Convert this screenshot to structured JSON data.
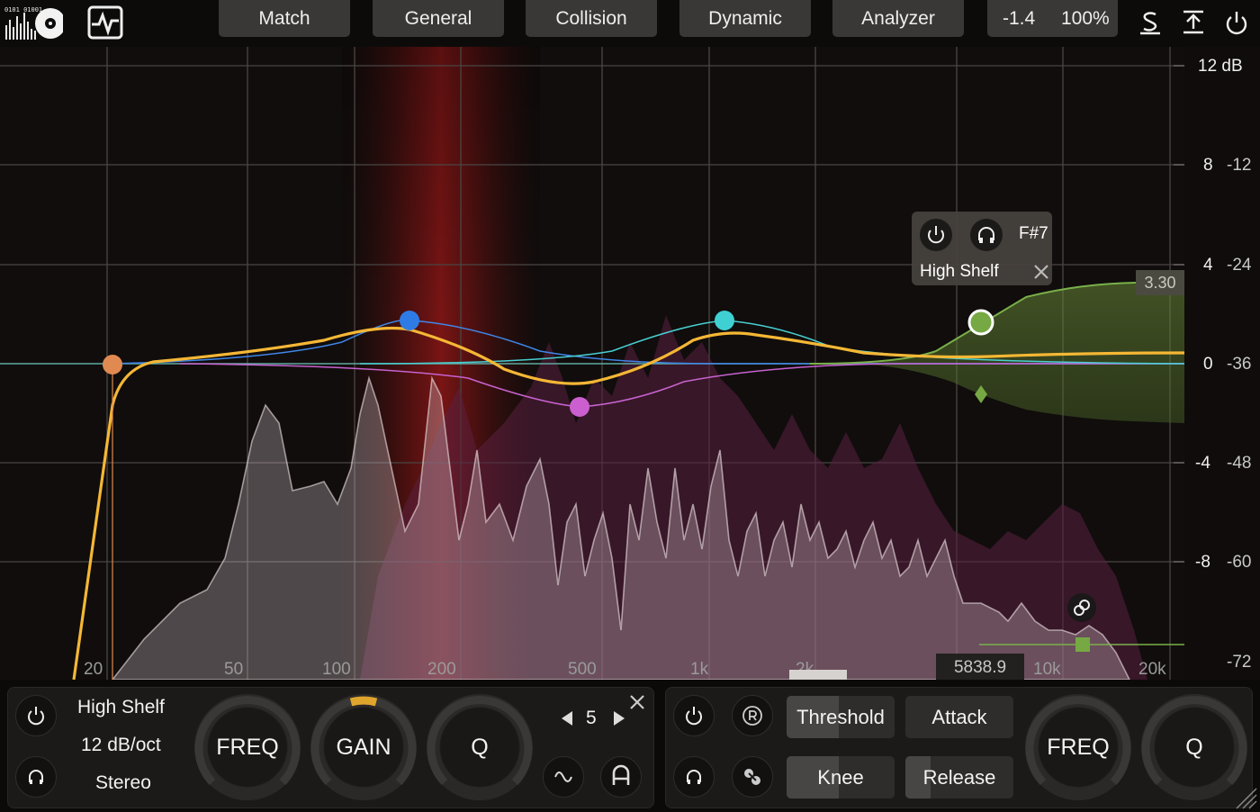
{
  "tabs": [
    {
      "label": "Match"
    },
    {
      "label": "General"
    },
    {
      "label": "Collision"
    },
    {
      "label": "Dynamic"
    },
    {
      "label": "Analyzer"
    }
  ],
  "output": {
    "gain": "-1.4",
    "mix": "100%"
  },
  "scale": {
    "db_range_labels": [
      "12 dB",
      "8",
      "4",
      "0",
      "-4",
      "-8"
    ],
    "spectrum_labels": [
      "-12",
      "-24",
      "-36",
      "-48",
      "-60",
      "-72"
    ]
  },
  "freq_axis": [
    "20",
    "50",
    "100",
    "200",
    "500",
    "1k",
    "2k",
    "10k",
    "20k"
  ],
  "popup": {
    "note": "F#7",
    "filter_type": "High Shelf"
  },
  "band_value": "3.30",
  "hover_freq": "5838.9",
  "band_panel": {
    "filter_type": "High Shelf",
    "slope": "12 dB/oct",
    "channel": "Stereo",
    "band_number": "5",
    "knobs": {
      "freq": "FREQ",
      "gain": "GAIN",
      "q": "Q"
    }
  },
  "dynamic_panel": {
    "buttons": {
      "threshold": "Threshold",
      "attack": "Attack",
      "knee": "Knee",
      "release": "Release"
    },
    "knobs": {
      "freq": "FREQ",
      "q": "Q"
    }
  },
  "colors": {
    "main_curve": "#f5b735",
    "band1": "#e08a52",
    "band2": "#2f7be6",
    "band3": "#cc5fd0",
    "band4": "#3fd0d3",
    "band5": "#76a843",
    "collision": "#7a1414"
  }
}
